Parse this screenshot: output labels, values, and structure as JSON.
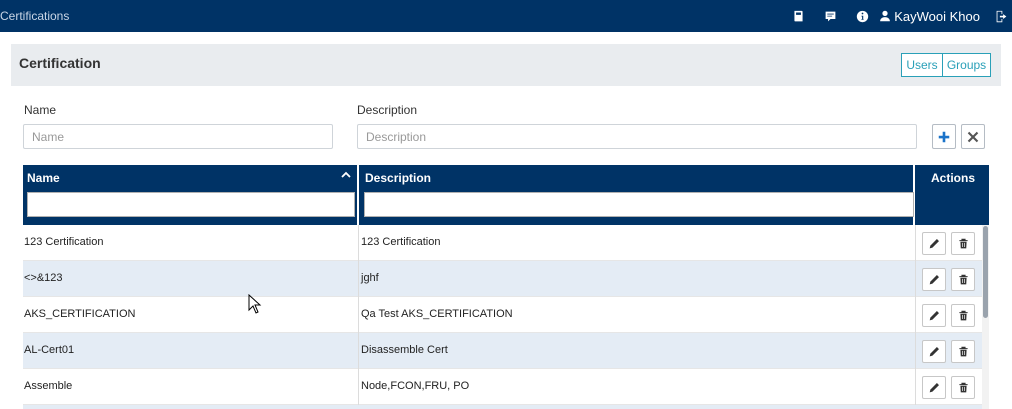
{
  "topbar": {
    "title": "Certifications",
    "user_name": "KayWooi Khoo",
    "icons": [
      "book-icon",
      "message-icon",
      "info-icon",
      "user-icon",
      "logout-icon"
    ]
  },
  "page": {
    "heading": "Certification",
    "users_toggle": "Users",
    "groups_toggle": "Groups"
  },
  "form": {
    "name_label": "Name",
    "name_placeholder": "Name",
    "name_value": "",
    "description_label": "Description",
    "description_placeholder": "Description",
    "description_value": ""
  },
  "table": {
    "columns": [
      "Name",
      "Description",
      "Actions"
    ],
    "sort": {
      "column": "Name",
      "direction": "ascending"
    },
    "filters": {
      "name": "",
      "description": ""
    },
    "rows": [
      {
        "name": "123 Certification",
        "description": "123 Certification"
      },
      {
        "name": "<>&123",
        "description": "jghf"
      },
      {
        "name": "AKS_CERTIFICATION",
        "description": "Qa Test AKS_CERTIFICATION"
      },
      {
        "name": "AL-Cert01",
        "description": "Disassemble Cert"
      },
      {
        "name": "Assemble",
        "description": "Node,FCON,FRU, PO"
      }
    ]
  },
  "colors": {
    "navy": "#003366",
    "accent": "#2aa0b8",
    "add": "#1a73c9",
    "row_alt": "#e4ecf5"
  }
}
